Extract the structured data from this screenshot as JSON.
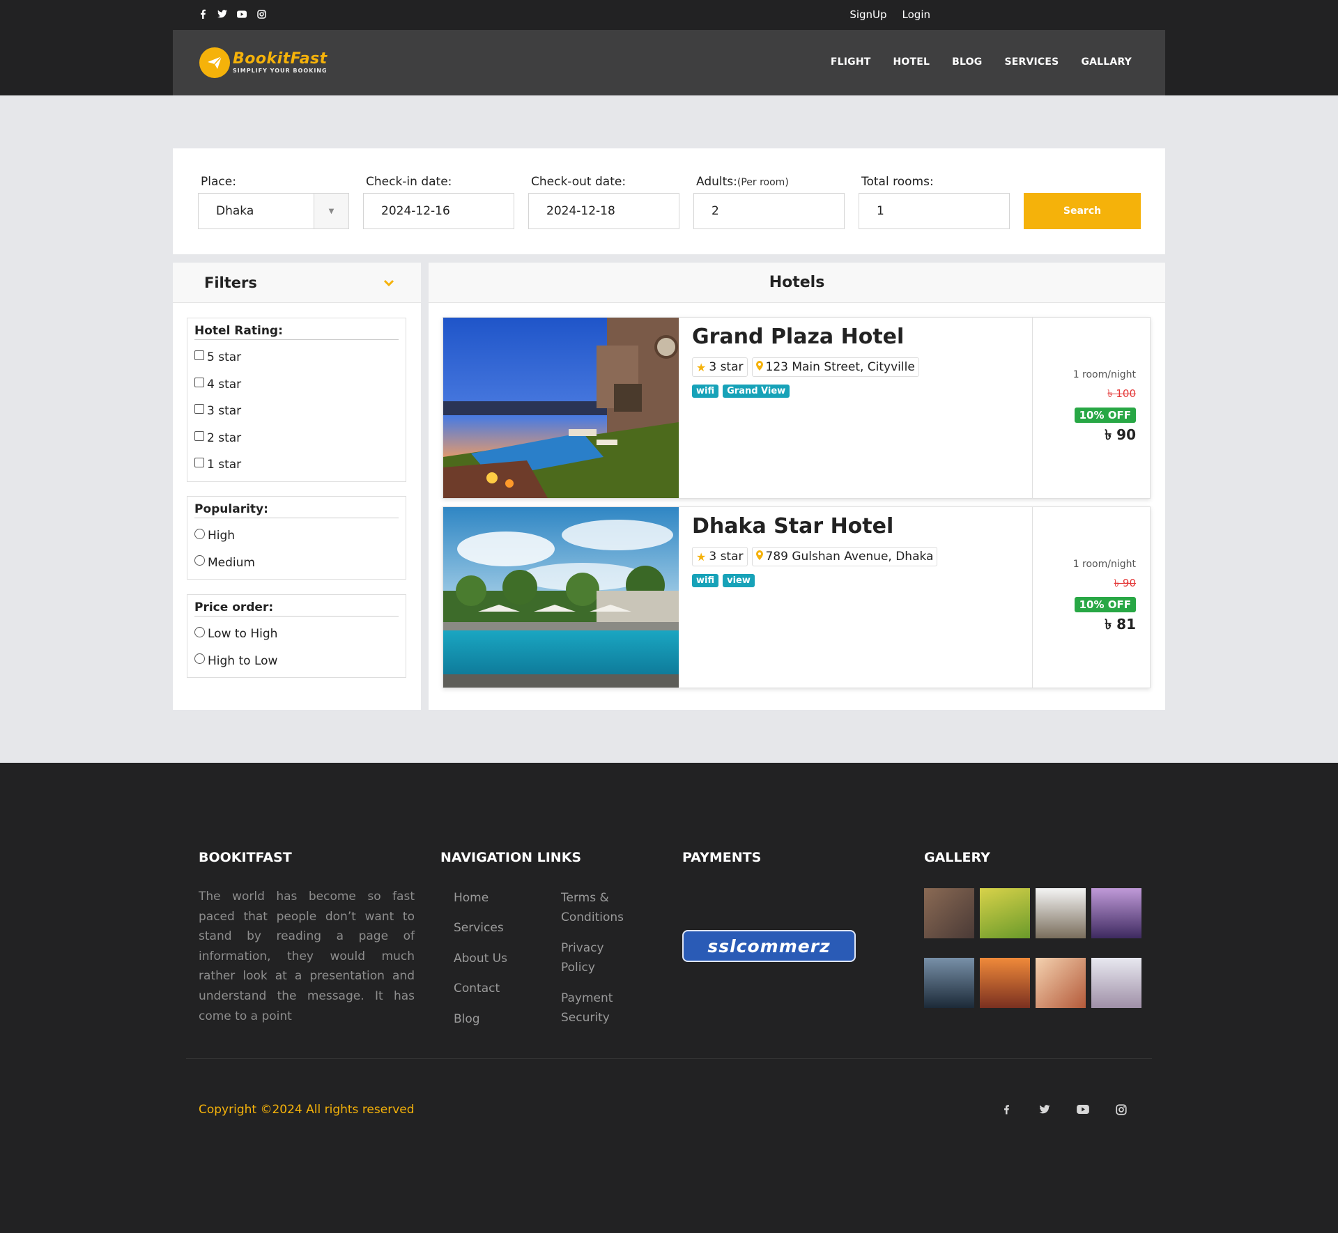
{
  "header": {
    "social_icons": [
      "facebook-icon",
      "twitter-icon",
      "youtube-icon",
      "instagram-icon"
    ],
    "auth": {
      "signup": "SignUp",
      "login": "Login"
    },
    "logo": {
      "name": "BookitFast",
      "tagline": "SIMPLIFY YOUR BOOKING"
    },
    "menu": [
      "FLIGHT",
      "HOTEL",
      "BLOG",
      "SERVICES",
      "GALLARY"
    ]
  },
  "search": {
    "place_label": "Place:",
    "place_value": "Dhaka",
    "checkin_label": "Check-in date:",
    "checkin_value": "2024-12-16",
    "checkout_label": "Check-out date:",
    "checkout_value": "2024-12-18",
    "adults_label": "Adults:",
    "adults_sub": "(Per room)",
    "adults_value": "2",
    "rooms_label": "Total rooms:",
    "rooms_value": "1",
    "button": "Search"
  },
  "filters": {
    "title": "Filters",
    "rating": {
      "title": "Hotel Rating:",
      "options": [
        "5 star",
        "4 star",
        "3 star",
        "2 star",
        "1 star"
      ]
    },
    "popularity": {
      "title": "Popularity:",
      "options": [
        "High",
        "Medium"
      ]
    },
    "price_order": {
      "title": "Price order:",
      "options": [
        "Low to High",
        "High to Low"
      ]
    }
  },
  "hotels": {
    "title": "Hotels",
    "items": [
      {
        "name": "Grand Plaza Hotel",
        "rating": "3 star",
        "address": "123 Main Street, Cityville",
        "tags": [
          "wifi",
          "Grand View"
        ],
        "per": "1 room/night",
        "old_price": "৳ 100",
        "discount": "10% OFF",
        "price": "৳ 90"
      },
      {
        "name": "Dhaka Star Hotel",
        "rating": "3 star",
        "address": "789 Gulshan Avenue, Dhaka",
        "tags": [
          "wifi",
          "view"
        ],
        "per": "1 room/night",
        "old_price": "৳ 90",
        "discount": "10% OFF",
        "price": "৳ 81"
      }
    ]
  },
  "footer": {
    "brand_title": "BOOKITFAST",
    "about": "The world has become so fast paced that people don’t want to stand by reading a page of information, they would much rather look at a presentation and understand the message. It has come to a point",
    "nav_title": "NAVIGATION LINKS",
    "nav_left": [
      "Home",
      "Services",
      "About Us",
      "Contact",
      "Blog"
    ],
    "nav_right": [
      "Terms & Conditions",
      "Privacy Policy",
      "Payment Security"
    ],
    "payments_title": "PAYMENTS",
    "payment_logo": "sslcommerz",
    "gallery_title": "GALLERY",
    "copyright": "Copyright ©2024 All rights reserved",
    "social_icons": [
      "facebook-icon",
      "twitter-icon",
      "youtube-icon",
      "instagram-icon"
    ]
  },
  "colors": {
    "accent": "#f5b20a",
    "dark": "#222223",
    "teal": "#17a2b8",
    "green": "#28a745",
    "red": "#e43a3a"
  }
}
